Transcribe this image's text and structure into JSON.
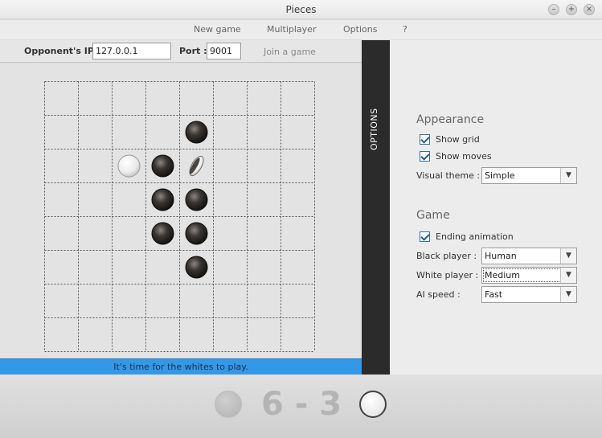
{
  "window": {
    "title": "Pieces"
  },
  "window_controls": {
    "minimize": "–",
    "maximize": "+",
    "close": "×"
  },
  "menu": {
    "items": [
      "New game",
      "Multiplayer",
      "Options",
      "?"
    ]
  },
  "connection": {
    "ip_label": "Opponent's IP :",
    "ip_value": "127.0.0.1",
    "port_label": "Port :",
    "port_value": "9001",
    "join_label": "Join a game"
  },
  "board": {
    "rows": 8,
    "cols": 8,
    "pieces": [
      {
        "row": 1,
        "col": 4,
        "color": "black"
      },
      {
        "row": 2,
        "col": 2,
        "color": "white"
      },
      {
        "row": 2,
        "col": 3,
        "color": "black"
      },
      {
        "row": 2,
        "col": 4,
        "color": "flipping"
      },
      {
        "row": 3,
        "col": 3,
        "color": "black"
      },
      {
        "row": 3,
        "col": 4,
        "color": "black"
      },
      {
        "row": 4,
        "col": 3,
        "color": "black"
      },
      {
        "row": 4,
        "col": 4,
        "color": "black"
      },
      {
        "row": 5,
        "col": 4,
        "color": "black"
      }
    ]
  },
  "status": {
    "text": "It's time for the whites to play."
  },
  "options_tab": {
    "label": "OPTIONS"
  },
  "options": {
    "appearance_title": "Appearance",
    "show_grid_label": "Show grid",
    "show_moves_label": "Show moves",
    "visual_theme_label": "Visual theme :",
    "visual_theme_value": "Simple",
    "game_title": "Game",
    "ending_animation_label": "Ending animation",
    "black_player_label": "Black player :",
    "black_player_value": "Human",
    "white_player_label": "White player :",
    "white_player_value": "Medium",
    "ai_speed_label": "AI speed :",
    "ai_speed_value": "Fast",
    "dropdown_arrow": "▼"
  },
  "score": {
    "text": "6 - 3"
  },
  "colors": {
    "status_bar": "#3399e6",
    "options_tab": "#2b2b2b"
  }
}
